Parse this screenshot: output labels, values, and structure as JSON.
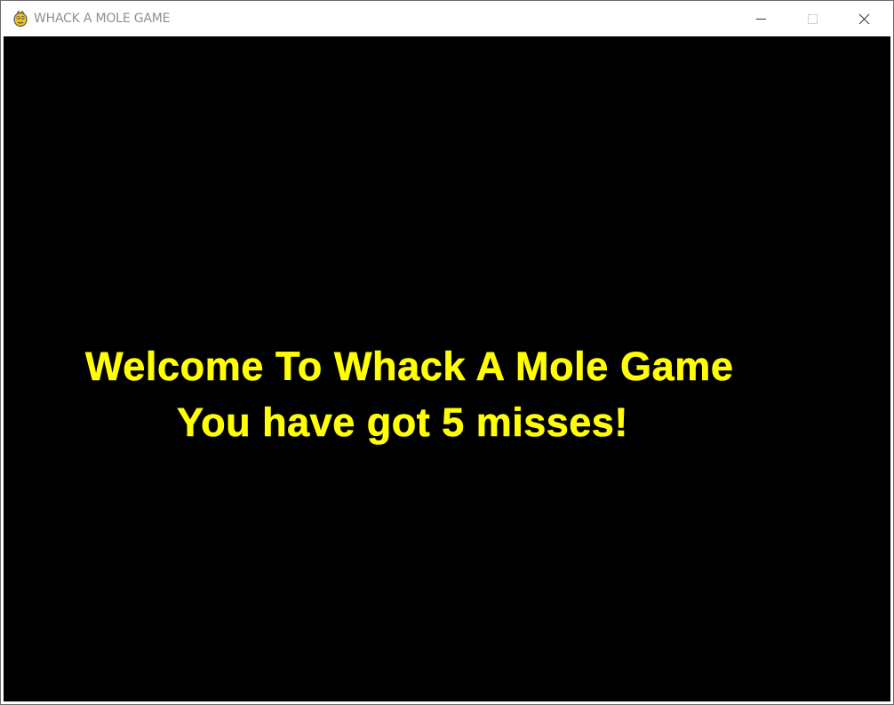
{
  "window": {
    "title": "WHACK A MOLE GAME",
    "icon": "pygame-snake-icon",
    "controls": [
      "minimize-icon",
      "maximize-icon",
      "close-icon"
    ]
  },
  "game": {
    "background_color": "#000000",
    "text_color": "#ffff00",
    "welcome_text": "Welcome To Whack A Mole Game",
    "result_text": "You have got 5 misses!"
  }
}
